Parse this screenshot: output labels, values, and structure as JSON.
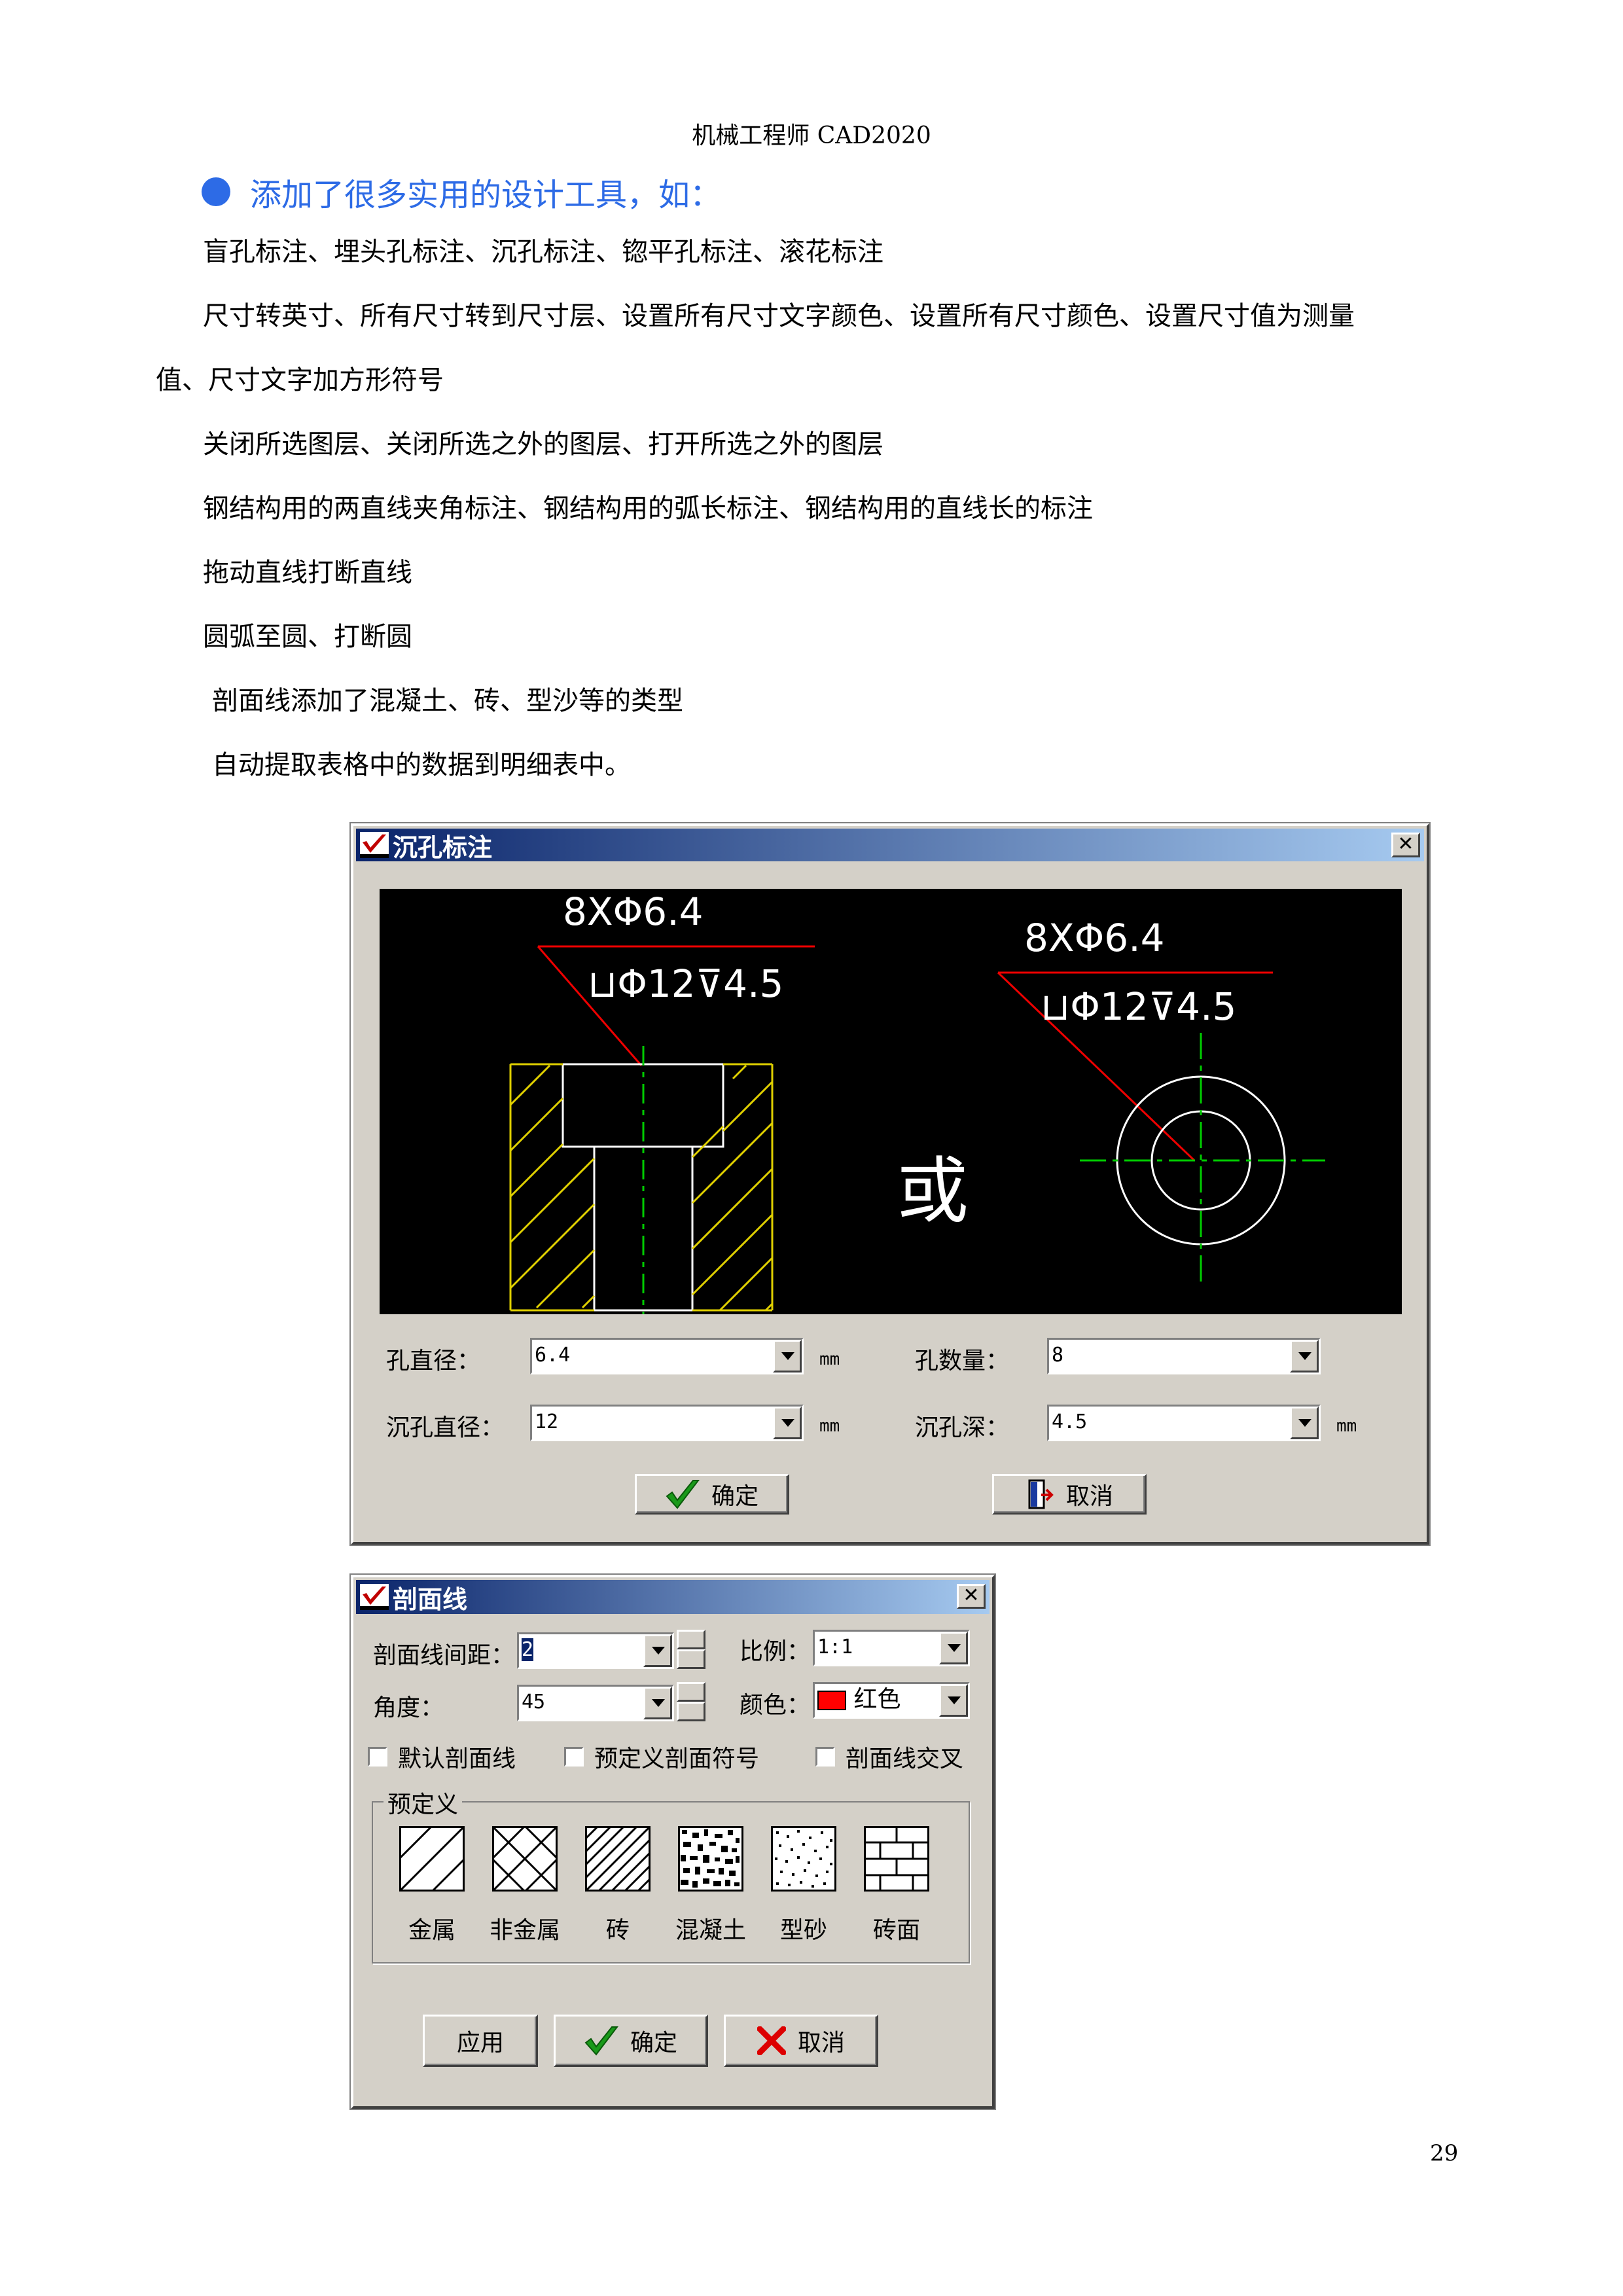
{
  "header": {
    "title": "机械工程师 CAD2020"
  },
  "bullet": {
    "text": "添加了很多实用的设计工具，如："
  },
  "paragraphs": {
    "p1": "盲孔标注、埋头孔标注、沉孔标注、锪平孔标注、滚花标注",
    "p2a": "尺寸转英寸、所有尺寸转到尺寸层、设置所有尺寸文字颜色、设置所有尺寸颜色、设置尺寸值为测量",
    "p2b": "值、尺寸文字加方形符号",
    "p3": "关闭所选图层、关闭所选之外的图层、打开所选之外的图层",
    "p4": "钢结构用的两直线夹角标注、钢结构用的弧长标注、钢结构用的直线长的标注",
    "p5": "拖动直线打断直线",
    "p6": "圆弧至圆、打断圆",
    "p7": "剖面线添加了混凝土、砖、型沙等的类型",
    "p8": "自动提取表格中的数据到明细表中。"
  },
  "dialog1": {
    "title": "沉孔标注",
    "close": "✕",
    "preview": {
      "left_top": "8XΦ6.4",
      "left_bottom": "⊔Φ12⊽4.5",
      "or": "或",
      "right_top": "8XΦ6.4",
      "right_bottom": "⊔Φ12⊽4.5"
    },
    "hole_diameter_label": "孔直径：",
    "hole_diameter_value": "6.4",
    "hole_count_label": "孔数量：",
    "hole_count_value": "8",
    "cb_diameter_label": "沉孔直径：",
    "cb_diameter_value": "12",
    "cb_depth_label": "沉孔深：",
    "cb_depth_value": "4.5",
    "unit": "mm",
    "ok": "确定",
    "cancel": "取消"
  },
  "dialog2": {
    "title": "剖面线",
    "close": "✕",
    "spacing_label": "剖面线间距：",
    "spacing_value": "2",
    "angle_label": "角度：",
    "angle_value": "45",
    "scale_label": "比例：",
    "scale_value": "1:1",
    "color_label": "颜色：",
    "color_value": "红色",
    "color_swatch": "#ff0000",
    "cb1": "默认剖面线",
    "cb2": "预定义剖面符号",
    "cb3": "剖面线交叉",
    "group_label": "预定义",
    "patterns": [
      "金属",
      "非金属",
      "砖",
      "混凝土",
      "型砂",
      "砖面"
    ],
    "apply": "应用",
    "ok": "确定",
    "cancel": "取消"
  },
  "page_number": "29"
}
